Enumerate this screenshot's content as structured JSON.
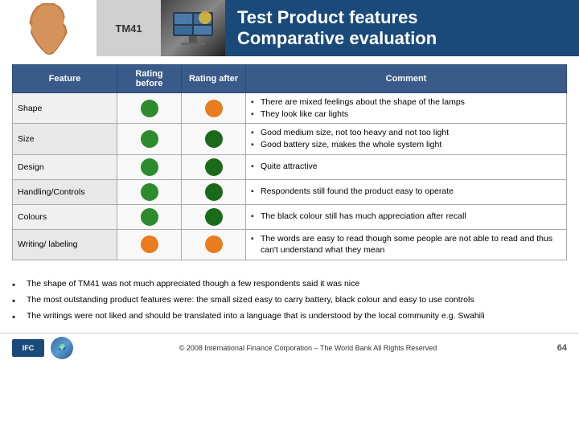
{
  "header": {
    "tm_label": "TM41",
    "title_line1": "Test Product features",
    "title_line2": "Comparative evaluation"
  },
  "table": {
    "headers": {
      "feature": "Feature",
      "rating_before": "Rating before",
      "rating_after": "Rating after",
      "comment": "Comment"
    },
    "rows": [
      {
        "feature": "Shape",
        "before_color": "green",
        "after_color": "orange",
        "comments": [
          "There are mixed feelings about the shape of the lamps",
          "They look like car lights"
        ]
      },
      {
        "feature": "Size",
        "before_color": "green",
        "after_color": "dark-green",
        "comments": [
          "Good medium size, not too heavy and not too light",
          "Good battery size, makes the whole system light"
        ]
      },
      {
        "feature": "Design",
        "before_color": "green",
        "after_color": "dark-green",
        "comments": [
          "Quite attractive"
        ]
      },
      {
        "feature": "Handling/Controls",
        "before_color": "green",
        "after_color": "dark-green",
        "comments": [
          "Respondents still found the product easy to operate"
        ]
      },
      {
        "feature": "Colours",
        "before_color": "green",
        "after_color": "dark-green",
        "comments": [
          "The black colour still has much appreciation after recall"
        ]
      },
      {
        "feature": "Writing/ labeling",
        "before_color": "orange",
        "after_color": "orange",
        "comments": [
          "The words are easy to read though some people are not able to read and thus can't understand what they mean"
        ]
      }
    ]
  },
  "bullets": [
    "The shape of TM41 was not much appreciated though a few respondents said it was nice",
    "The most outstanding product features were: the small sized easy to carry battery, black colour and easy to use controls",
    "The writings were not liked and should be translated into a language that is understood by the local community e.g. Swahili"
  ],
  "footer": {
    "copyright": "© 2008 International Finance Corporation – The World Bank All Rights Reserved",
    "page": "64"
  }
}
